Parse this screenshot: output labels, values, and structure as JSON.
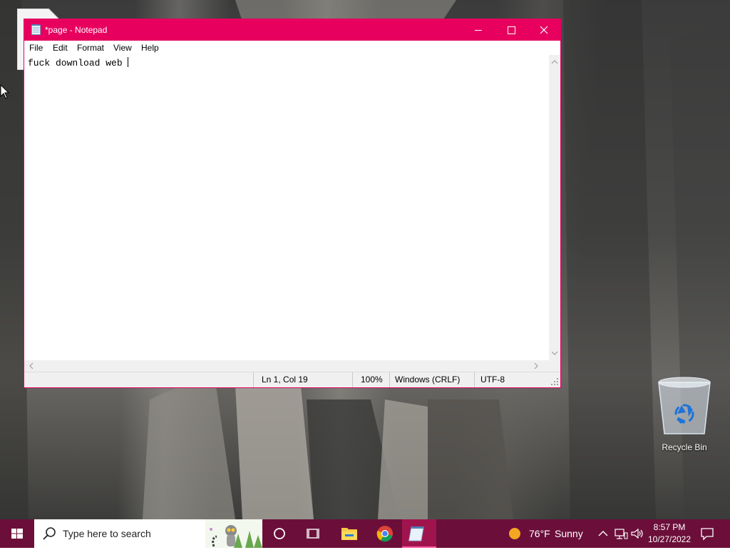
{
  "notepad": {
    "title": "*page - Notepad",
    "menu": [
      "File",
      "Edit",
      "Format",
      "View",
      "Help"
    ],
    "content": "fuck download web ",
    "status": {
      "position": "Ln 1, Col 19",
      "zoom": "100%",
      "line_ending": "Windows (CRLF)",
      "encoding": "UTF-8"
    },
    "accent_color": "#e8005f"
  },
  "desktop": {
    "recycle_bin_label": "Recycle Bin"
  },
  "taskbar": {
    "search_placeholder": "Type here to search",
    "apps": [
      "task-view",
      "file-explorer",
      "chrome",
      "notepad"
    ],
    "weather": {
      "temp": "76°F",
      "condition": "Sunny"
    },
    "clock": {
      "time": "8:57 PM",
      "date": "10/27/2022"
    },
    "color": "#6b0f3a"
  }
}
